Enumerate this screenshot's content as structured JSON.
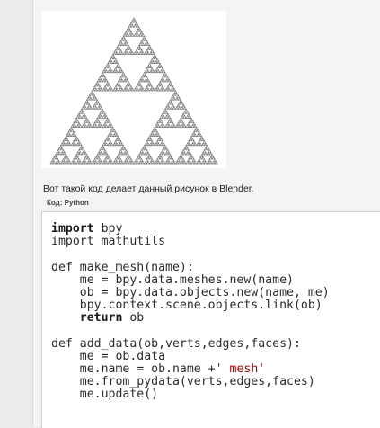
{
  "post": {
    "top_cut_text": "— — — — — — — — — — — — — — — — —",
    "caption": "Вот такой код делает данный рисунок в Blender.",
    "code_label": "Код: Python"
  },
  "figure": {
    "depth": 6,
    "stroke_color": "#7a7a7a",
    "background": "#ffffff"
  },
  "code": {
    "lines": [
      [
        {
          "t": "import",
          "c": "kw"
        },
        {
          "t": " bpy"
        }
      ],
      [
        {
          "t": "import mathutils"
        }
      ],
      [],
      [
        {
          "t": "def make_mesh(name):"
        }
      ],
      [
        {
          "t": "    me = bpy.data.meshes.new(name)"
        }
      ],
      [
        {
          "t": "    ob = bpy.data.objects.new(name, me)"
        }
      ],
      [
        {
          "t": "    bpy.context.scene.objects.link(ob)"
        }
      ],
      [
        {
          "t": "    "
        },
        {
          "t": "return",
          "c": "kw"
        },
        {
          "t": " ob"
        }
      ],
      [],
      [
        {
          "t": "def add_data(ob,verts,edges,faces):"
        }
      ],
      [
        {
          "t": "    me = ob.data"
        }
      ],
      [
        {
          "t": "    me.name = ob.name +"
        },
        {
          "t": "' mesh'",
          "c": "str"
        }
      ],
      [
        {
          "t": "    me.from_pydata(verts,edges,faces)"
        }
      ],
      [
        {
          "t": "    me.update()"
        }
      ]
    ]
  }
}
